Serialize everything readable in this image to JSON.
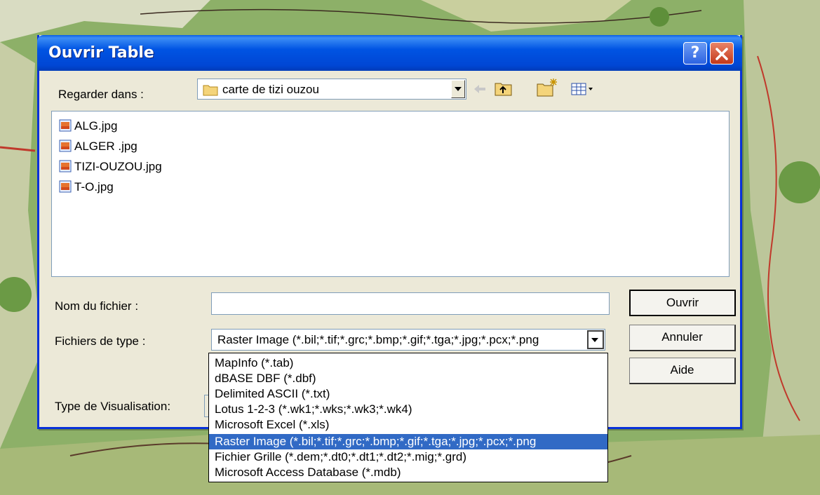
{
  "dialog": {
    "title": "Ouvrir Table",
    "help_glyph": "?",
    "look_in": {
      "label": "Regarder dans :",
      "value": "carte de tizi ouzou",
      "folder_icon": "folder-icon"
    },
    "toolbar_icons": [
      "back-arrow-icon",
      "up-one-level-icon",
      "new-folder-icon",
      "view-menu-icon"
    ],
    "files": [
      {
        "name": "ALG.jpg",
        "icon": "image-file-icon"
      },
      {
        "name": "ALGER .jpg",
        "icon": "image-file-icon"
      },
      {
        "name": "TIZI-OUZOU.jpg",
        "icon": "image-file-icon"
      },
      {
        "name": "T-O.jpg",
        "icon": "image-file-icon"
      }
    ],
    "filename": {
      "label": "Nom du fichier :",
      "value": ""
    },
    "filetype": {
      "label": "Fichiers de type :",
      "value": "Raster Image (*.bil;*.tif;*.grc;*.bmp;*.gif;*.tga;*.jpg;*.pcx;*.png"
    },
    "viz_type": {
      "label": "Type de Visualisation:"
    },
    "buttons": {
      "open": "Ouvrir",
      "cancel": "Annuler",
      "help": "Aide"
    },
    "dropdown": {
      "options": [
        "MapInfo (*.tab)",
        "dBASE DBF (*.dbf)",
        "Delimited ASCII (*.txt)",
        "Lotus 1-2-3 (*.wk1;*.wks;*.wk3;*.wk4)",
        "Microsoft Excel (*.xls)",
        "Raster Image (*.bil;*.tif;*.grc;*.bmp;*.gif;*.tga;*.jpg;*.pcx;*.png",
        "Fichier Grille (*.dem;*.dt0;*.dt1;*.dt2;*.mig;*.grd)",
        "Microsoft Access Database (*.mdb)"
      ],
      "selected_index": 5
    }
  },
  "colors": {
    "title_bar": "#0054e3",
    "selection": "#316ac5",
    "dialog_bg": "#ece9d8"
  }
}
